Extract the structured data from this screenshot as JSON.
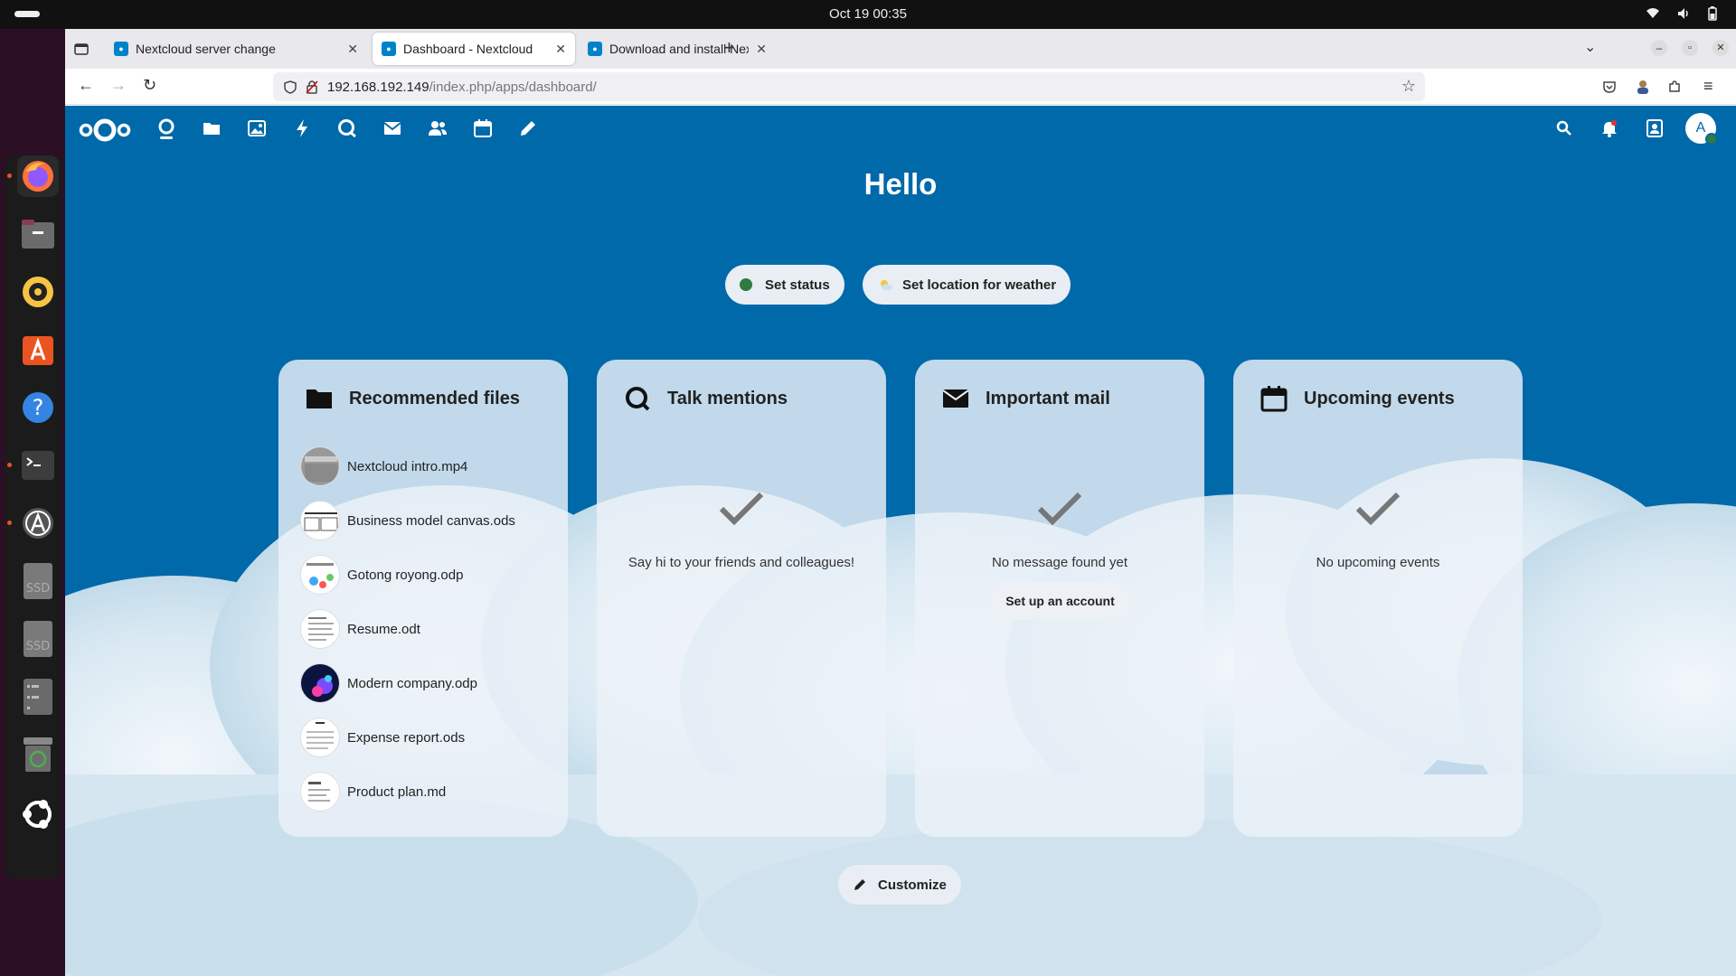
{
  "system": {
    "clock": "Oct 19  00:35"
  },
  "browser": {
    "tabs": [
      {
        "title": "Nextcloud server change",
        "active": false
      },
      {
        "title": "Dashboard - Nextcloud",
        "active": true
      },
      {
        "title": "Download and install Nex",
        "active": false
      }
    ],
    "url_host": "192.168.192.149",
    "url_path": "/index.php/apps/dashboard/"
  },
  "dashboard": {
    "greeting": "Hello",
    "status_label": "Set status",
    "weather_label": "Set location for weather",
    "customize_label": "Customize",
    "widgets": {
      "files": {
        "title": "Recommended files",
        "items": [
          "Nextcloud intro.mp4",
          "Business model canvas.ods",
          "Gotong royong.odp",
          "Resume.odt",
          "Modern company.odp",
          "Expense report.ods",
          "Product plan.md"
        ]
      },
      "talk": {
        "title": "Talk mentions",
        "empty_text": "Say hi to your friends and colleagues!"
      },
      "mail": {
        "title": "Important mail",
        "empty_text": "No message found yet",
        "setup_label": "Set up an account"
      },
      "events": {
        "title": "Upcoming events",
        "empty_text": "No upcoming events"
      }
    }
  },
  "user": {
    "avatar_letter": "A"
  },
  "colors": {
    "nextcloud_blue": "#0069aa",
    "status_online": "#2d7b41",
    "accent": "#0082c9"
  }
}
